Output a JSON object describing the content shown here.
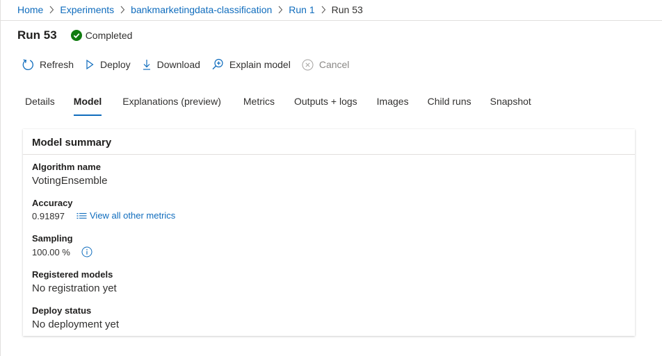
{
  "breadcrumb": {
    "items": [
      "Home",
      "Experiments",
      "bankmarketingdata-classification",
      "Run 1"
    ],
    "current": "Run 53"
  },
  "header": {
    "title": "Run 53",
    "status": "Completed",
    "status_color": "#107c10"
  },
  "toolbar": {
    "refresh": "Refresh",
    "deploy": "Deploy",
    "download": "Download",
    "explain": "Explain model",
    "cancel": "Cancel"
  },
  "tabs": [
    "Details",
    "Model",
    "Explanations (preview)",
    "Metrics",
    "Outputs + logs",
    "Images",
    "Child runs",
    "Snapshot"
  ],
  "active_tab": "Model",
  "summary": {
    "title": "Model summary",
    "algorithm_label": "Algorithm name",
    "algorithm_value": "VotingEnsemble",
    "accuracy_label": "Accuracy",
    "accuracy_value": "0.91897",
    "metrics_link": "View all other metrics",
    "sampling_label": "Sampling",
    "sampling_value": "100.00 %",
    "registered_label": "Registered models",
    "registered_value": "No registration yet",
    "deploy_label": "Deploy status",
    "deploy_value": "No deployment yet"
  },
  "colors": {
    "accent": "#0f6cbd",
    "success": "#107c10",
    "disabled": "#8a8886"
  }
}
